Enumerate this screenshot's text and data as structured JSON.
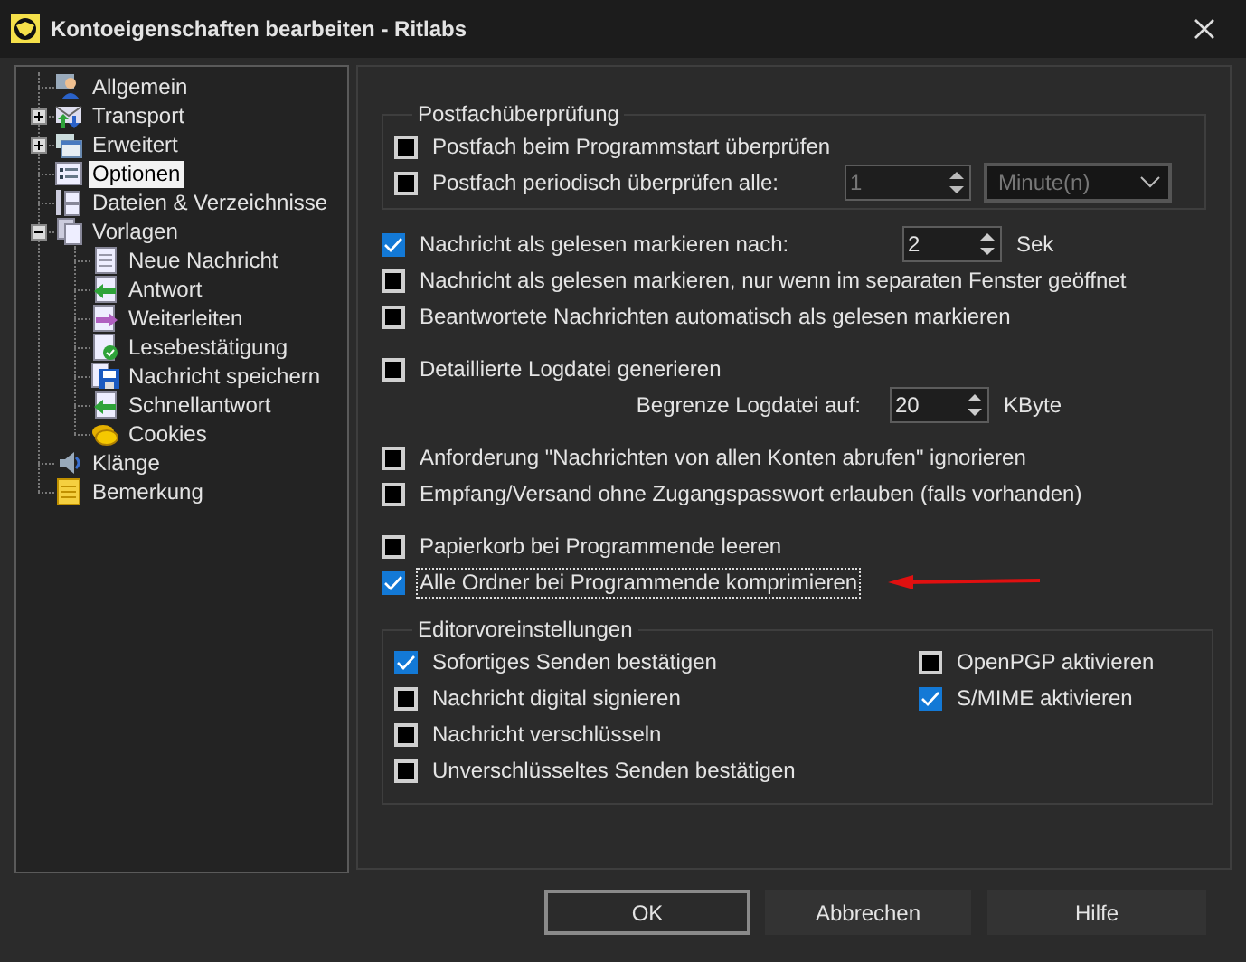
{
  "window": {
    "title": "Kontoeigenschaften bearbeiten - Ritlabs"
  },
  "tree": [
    {
      "label": "Allgemein",
      "selected": false
    },
    {
      "label": "Transport",
      "selected": false,
      "expanded": false
    },
    {
      "label": "Erweitert",
      "selected": false,
      "expanded": false
    },
    {
      "label": "Optionen",
      "selected": true
    },
    {
      "label": "Dateien & Verzeichnisse",
      "selected": false
    },
    {
      "label": "Vorlagen",
      "selected": false,
      "expanded": true,
      "children": [
        {
          "label": "Neue Nachricht",
          "selected": false
        },
        {
          "label": "Antwort",
          "selected": false
        },
        {
          "label": "Weiterleiten",
          "selected": false
        },
        {
          "label": "Lesebestätigung",
          "selected": false
        },
        {
          "label": "Nachricht speichern",
          "selected": false
        },
        {
          "label": "Schnellantwort",
          "selected": false
        },
        {
          "label": "Cookies",
          "selected": false
        }
      ]
    },
    {
      "label": "Klänge",
      "selected": false
    },
    {
      "label": "Bemerkung",
      "selected": false
    }
  ],
  "sections": [
    {
      "kind": "group",
      "legend": "Postfachüberprüfung",
      "rows": [
        {
          "kind": "checkbox",
          "label": "Postfach beim Programmstart überprüfen",
          "checked": false
        },
        {
          "kind": "checkbox",
          "label": "Postfach periodisch überprüfen alle:",
          "checked": false,
          "spinner": {
            "value": "1",
            "disabled": true
          },
          "dropdown": {
            "value": "Minute(n)",
            "disabled": true
          }
        }
      ]
    },
    {
      "kind": "plain",
      "rows": [
        {
          "kind": "checkbox",
          "label": "Nachricht als gelesen markieren nach:",
          "checked": true,
          "spinner": {
            "value": "2",
            "disabled": false
          },
          "unit": "Sek"
        },
        {
          "kind": "checkbox",
          "label": "Nachricht als gelesen markieren, nur wenn im separaten Fenster geöffnet",
          "checked": false
        },
        {
          "kind": "checkbox",
          "label": "Beantwortete Nachrichten automatisch als gelesen markieren",
          "checked": false
        }
      ]
    },
    {
      "kind": "plain",
      "rows": [
        {
          "kind": "checkbox",
          "label": "Detaillierte Logdatei generieren",
          "checked": false
        },
        {
          "kind": "spin",
          "label": "Begrenze Logdatei auf:",
          "spinner": {
            "value": "20",
            "disabled": false
          },
          "unit": "KByte"
        }
      ]
    },
    {
      "kind": "plain",
      "rows": [
        {
          "kind": "checkbox",
          "label": "Anforderung \"Nachrichten von allen Konten abrufen\" ignorieren",
          "checked": false
        },
        {
          "kind": "checkbox",
          "label": "Empfang/Versand ohne Zugangspasswort erlauben (falls vorhanden)",
          "checked": false
        }
      ]
    },
    {
      "kind": "plain",
      "rows": [
        {
          "kind": "checkbox",
          "label": "Papierkorb bei Programmende leeren",
          "checked": false
        },
        {
          "kind": "checkbox",
          "label": "Alle Ordner bei Programmende komprimieren",
          "checked": true,
          "focused": true,
          "arrow": true
        }
      ]
    },
    {
      "kind": "columns",
      "legend": "Editorvoreinstellungen",
      "columns": [
        [
          {
            "kind": "checkbox",
            "label": "Sofortiges Senden bestätigen",
            "checked": true
          },
          {
            "kind": "checkbox",
            "label": "Nachricht digital signieren",
            "checked": false
          },
          {
            "kind": "checkbox",
            "label": "Nachricht verschlüsseln",
            "checked": false
          },
          {
            "kind": "checkbox",
            "label": "Unverschlüsseltes Senden bestätigen",
            "checked": false
          }
        ],
        [
          {
            "kind": "checkbox",
            "label": "OpenPGP aktivieren",
            "checked": false
          },
          {
            "kind": "checkbox",
            "label": "S/MIME aktivieren",
            "checked": true
          }
        ]
      ]
    }
  ],
  "buttons": [
    {
      "label": "OK",
      "default": true
    },
    {
      "label": "Abbrechen",
      "default": false
    },
    {
      "label": "Hilfe",
      "default": false
    }
  ]
}
